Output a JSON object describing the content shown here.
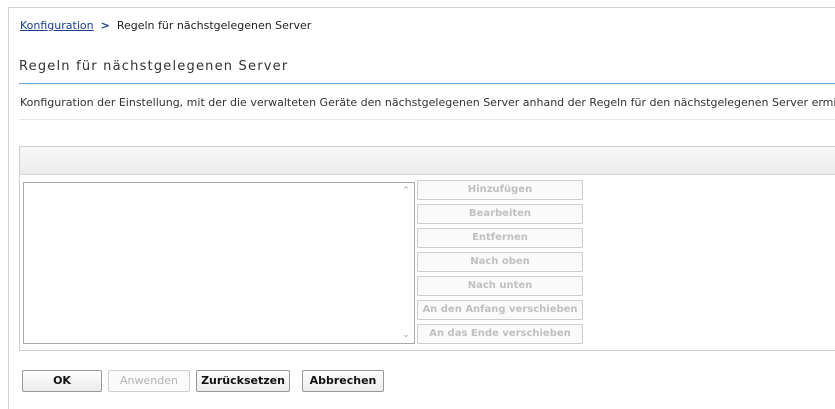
{
  "breadcrumb": {
    "link": "Konfiguration",
    "separator": ">",
    "current": "Regeln für nächstgelegenen Server"
  },
  "page": {
    "title": "Regeln für nächstgelegenen Server",
    "description": "Konfiguration der Einstellung, mit der die verwalteten Geräte den nächstgelegenen Server anhand der Regeln für den nächstgelegenen Server ermittel"
  },
  "list": {
    "scroll_up": "⌃",
    "scroll_down": "⌄"
  },
  "side_buttons": [
    {
      "label": "Hinzufügen"
    },
    {
      "label": "Bearbeiten"
    },
    {
      "label": "Entfernen"
    },
    {
      "label": "Nach oben"
    },
    {
      "label": "Nach unten"
    },
    {
      "label": "An den Anfang verschieben"
    },
    {
      "label": "An das Ende verschieben"
    }
  ],
  "footer": {
    "ok": "OK",
    "apply": "Anwenden",
    "reset": "Zurücksetzen",
    "cancel": "Abbrechen"
  }
}
